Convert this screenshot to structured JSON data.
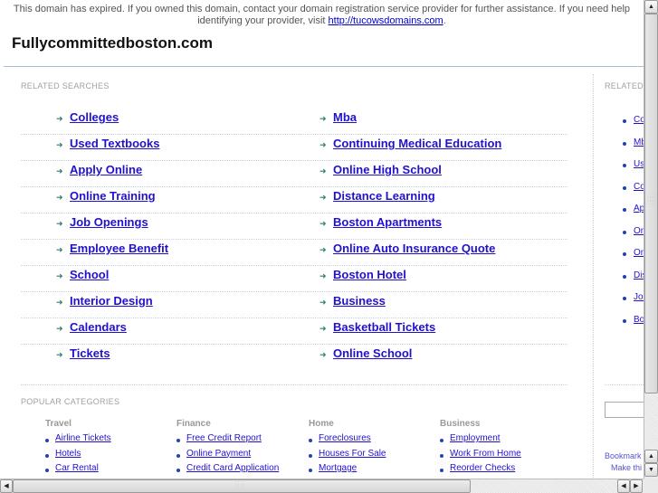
{
  "notice": {
    "text": "This domain has expired. If you owned this domain, contact your domain registration service provider for further assistance. If you need help identifying your provider, visit ",
    "link": "http://tucowsdomains.com",
    "suffix": "."
  },
  "site_title": "Fullycommittedboston.com",
  "related_searches": {
    "label": "RELATED SEARCHES",
    "left": [
      "Colleges",
      "Used Textbooks",
      "Apply Online",
      "Online Training",
      "Job Openings",
      "Employee Benefit",
      "School",
      "Interior Design",
      "Calendars",
      "Tickets"
    ],
    "right": [
      "Mba",
      "Continuing Medical Education",
      "Online High School",
      "Distance Learning",
      "Boston Apartments",
      "Online Auto Insurance Quote",
      "Boston Hotel",
      "Business",
      "Basketball Tickets",
      "Online School"
    ]
  },
  "sidebar": {
    "label": "RELATED",
    "items": [
      "Co",
      "Mb",
      "Us",
      "Co",
      "Ap",
      "On",
      "On",
      "Dis",
      "Jol",
      "Bo"
    ],
    "bookmark_line1": "Bookmark",
    "bookmark_line2": "Make thi"
  },
  "popular_categories": {
    "label": "POPULAR CATEGORIES",
    "columns": [
      {
        "title": "Travel",
        "items": [
          "Airline Tickets",
          "Hotels",
          "Car Rental"
        ]
      },
      {
        "title": "Finance",
        "items": [
          "Free Credit Report",
          "Online Payment",
          "Credit Card Application"
        ]
      },
      {
        "title": "Home",
        "items": [
          "Foreclosures",
          "Houses For Sale",
          "Mortgage"
        ]
      },
      {
        "title": "Business",
        "items": [
          "Employment",
          "Work From Home",
          "Reorder Checks"
        ]
      }
    ]
  },
  "icons": {
    "arrow": "➜",
    "scroll_up": "▲",
    "scroll_down": "▼",
    "scroll_left": "◀",
    "scroll_right": "▶",
    "grip": "⠿"
  },
  "colors": {
    "link": "#2211cc",
    "arrow": "#2a7f6f",
    "label": "#a0a0a0"
  }
}
